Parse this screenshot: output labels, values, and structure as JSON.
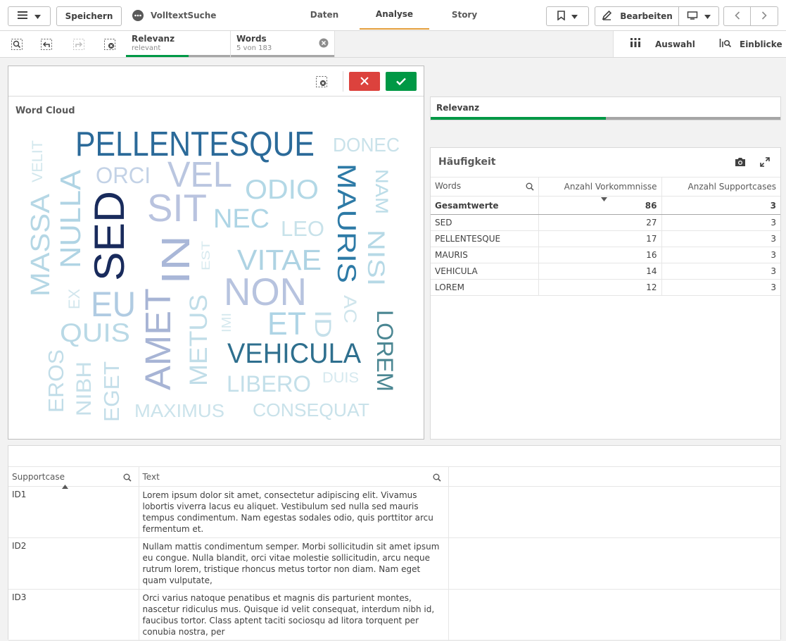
{
  "topbar": {
    "save_label": "Speichern",
    "app_name": "VolltextSuche",
    "tabs": [
      {
        "label": "Daten",
        "active": false
      },
      {
        "label": "Analyse",
        "active": true
      },
      {
        "label": "Story",
        "active": false
      }
    ],
    "edit_label": "Bearbeiten"
  },
  "selections": {
    "chips": [
      {
        "title": "Relevanz",
        "subtitle": "relevant",
        "fill_fraction": 0.6
      },
      {
        "title": "Words",
        "subtitle": "5 von 183",
        "fill_fraction": 0.0
      }
    ],
    "auswahl_label": "Auswahl",
    "einblicke_label": "Einblicke"
  },
  "wordcloud": {
    "title": "Word Cloud",
    "words": [
      {
        "text": "PELLENTESQUE",
        "color": "#2b6a99"
      },
      {
        "text": "DONEC",
        "color": "#c9e2ea"
      },
      {
        "text": "VELIT",
        "color": "#d2e7ed"
      },
      {
        "text": "ORCI",
        "color": "#c3d2e6"
      },
      {
        "text": "VEL",
        "color": "#bac6e0"
      },
      {
        "text": "ODIO",
        "color": "#b3d8e6"
      },
      {
        "text": "MAURIS",
        "color": "#2d7aa6"
      },
      {
        "text": "NAM",
        "color": "#bcdde8"
      },
      {
        "text": "SIT",
        "color": "#b9c3df"
      },
      {
        "text": "NEC",
        "color": "#aed5e5"
      },
      {
        "text": "LEO",
        "color": "#c8e2ea"
      },
      {
        "text": "NULLA",
        "color": "#b0d4e4"
      },
      {
        "text": "MASSA",
        "color": "#b5d7e5"
      },
      {
        "text": "SED",
        "color": "#192b5c"
      },
      {
        "text": "IN",
        "color": "#a9b7d8"
      },
      {
        "text": "EST",
        "color": "#d6e9ef"
      },
      {
        "text": "VITAE",
        "color": "#aed3e3"
      },
      {
        "text": "NISI",
        "color": "#b6d9e6"
      },
      {
        "text": "NON",
        "color": "#b7c3df"
      },
      {
        "text": "EU",
        "color": "#b0cbe2"
      },
      {
        "text": "EX",
        "color": "#d2e6ed"
      },
      {
        "text": "AMET",
        "color": "#a7b4d5"
      },
      {
        "text": "METUS",
        "color": "#c0dde8"
      },
      {
        "text": "IMI",
        "color": "#d6e9ef"
      },
      {
        "text": "ET",
        "color": "#aed4e5"
      },
      {
        "text": "ID",
        "color": "#c5e0ea"
      },
      {
        "text": "AC",
        "color": "#cfe5ec"
      },
      {
        "text": "LOREM",
        "color": "#4a8692"
      },
      {
        "text": "QUIS",
        "color": "#b9d9e6"
      },
      {
        "text": "VEHICULA",
        "color": "#2e6f8e"
      },
      {
        "text": "EROS",
        "color": "#c1dde8"
      },
      {
        "text": "NIBH",
        "color": "#c6e0ea"
      },
      {
        "text": "EGET",
        "color": "#c3dee9"
      },
      {
        "text": "LIBERO",
        "color": "#c3dfe9"
      },
      {
        "text": "DUIS",
        "color": "#d6e9ef"
      },
      {
        "text": "MAXIMUS",
        "color": "#cbe3eb"
      },
      {
        "text": "CONSEQUAT",
        "color": "#c9e2ea"
      }
    ]
  },
  "relevanz": {
    "title": "Relevanz",
    "fill_fraction": 0.5
  },
  "haeufigkeit": {
    "title": "Häufigkeit",
    "columns": [
      "Words",
      "Anzahl Vorkommnisse",
      "Anzahl Supportcases"
    ],
    "totals_label": "Gesamtwerte",
    "totals": [
      "86",
      "3"
    ],
    "rows": [
      [
        "SED",
        "27",
        "3"
      ],
      [
        "PELLENTESQUE",
        "17",
        "3"
      ],
      [
        "MAURIS",
        "16",
        "3"
      ],
      [
        "VEHICULA",
        "14",
        "3"
      ],
      [
        "LOREM",
        "12",
        "3"
      ]
    ]
  },
  "supportcases": {
    "columns": [
      "Supportcase",
      "Text"
    ],
    "rows": [
      {
        "id": "ID1",
        "text": "Lorem ipsum dolor sit amet, consectetur adipiscing elit. Vivamus lobortis viverra lacus eu aliquet. Vestibulum sed nulla sed mauris tempus condimentum. Nam egestas sodales odio, quis porttitor arcu fermentum et."
      },
      {
        "id": "ID2",
        "text": "Nullam mattis condimentum semper. Morbi sollicitudin sit amet ipsum eu congue. Nulla blandit, orci vitae molestie sollicitudin, arcu neque rutrum lorem, tristique rhoncus metus tortor non diam. Nam eget quam vulputate,"
      },
      {
        "id": "ID3",
        "text": "Orci varius natoque penatibus et magnis dis parturient montes, nascetur ridiculus mus. Quisque id velit consequat, interdum nibh id, faucibus tortor. Class aptent taciti sociosqu ad litora torquent per conubia nostra, per"
      }
    ]
  },
  "colors": {
    "accent_green": "#009845",
    "cancel_red": "#dc423d",
    "tab_underline": "#e39e3b"
  }
}
